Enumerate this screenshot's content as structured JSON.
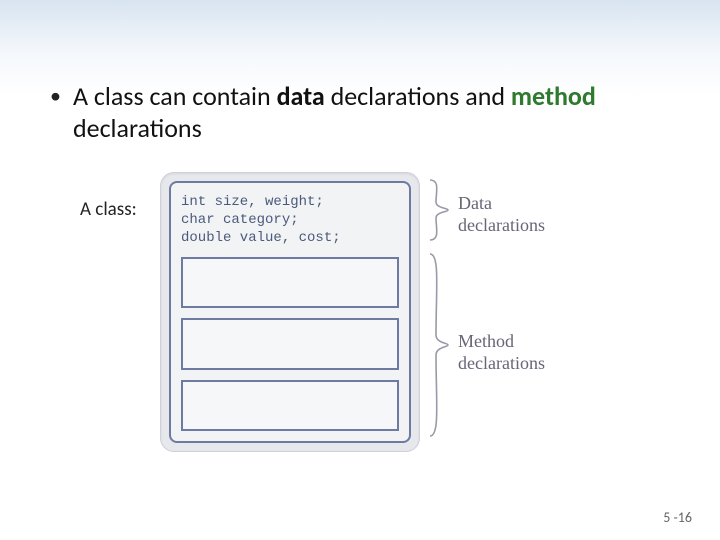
{
  "bullet": {
    "pre": "A class can contain ",
    "data_word": "data",
    "mid": " declarations and ",
    "method_word": "method",
    "post": " declarations"
  },
  "label": "A class:",
  "code": {
    "line1": "int size, weight;",
    "line2": "char category;",
    "line3": "double value, cost;"
  },
  "anno_data_l1": "Data",
  "anno_data_l2": "declarations",
  "anno_method_l1": "Method",
  "anno_method_l2": "declarations",
  "page": "5 -16"
}
